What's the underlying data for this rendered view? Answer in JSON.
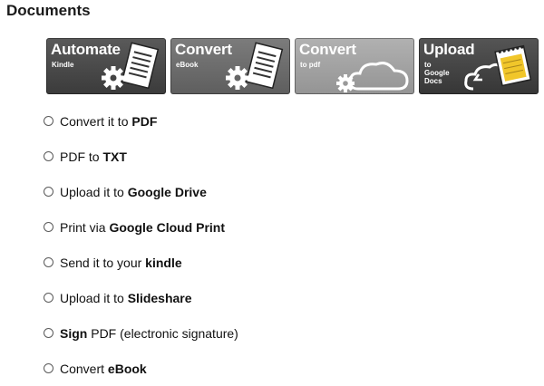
{
  "section": {
    "title": "Documents"
  },
  "tiles": [
    {
      "title": "Automate",
      "subtitle": "Kindle",
      "icon": "gear-document-icon"
    },
    {
      "title": "Convert",
      "subtitle": "eBook",
      "icon": "gear-document-icon"
    },
    {
      "title": "Convert",
      "subtitle": "to pdf",
      "icon": "gear-cloud-icon"
    },
    {
      "title": "Upload",
      "subtitle": "to\nGoogle\nDocs",
      "icon": "notepad-cloud-icon"
    }
  ],
  "options": [
    {
      "pre": "Convert it to ",
      "bold": "PDF",
      "post": ""
    },
    {
      "pre": "PDF to ",
      "bold": "TXT",
      "post": ""
    },
    {
      "pre": "Upload it to ",
      "bold": "Google Drive",
      "post": ""
    },
    {
      "pre": "Print via ",
      "bold": "Google Cloud Print",
      "post": ""
    },
    {
      "pre": "Send it to your ",
      "bold": "kindle",
      "post": ""
    },
    {
      "pre": "Upload it to ",
      "bold": "Slideshare",
      "post": ""
    },
    {
      "pre": "",
      "bold": "Sign",
      "post": " PDF (electronic signature)"
    },
    {
      "pre": "Convert ",
      "bold": "eBook",
      "post": ""
    }
  ]
}
